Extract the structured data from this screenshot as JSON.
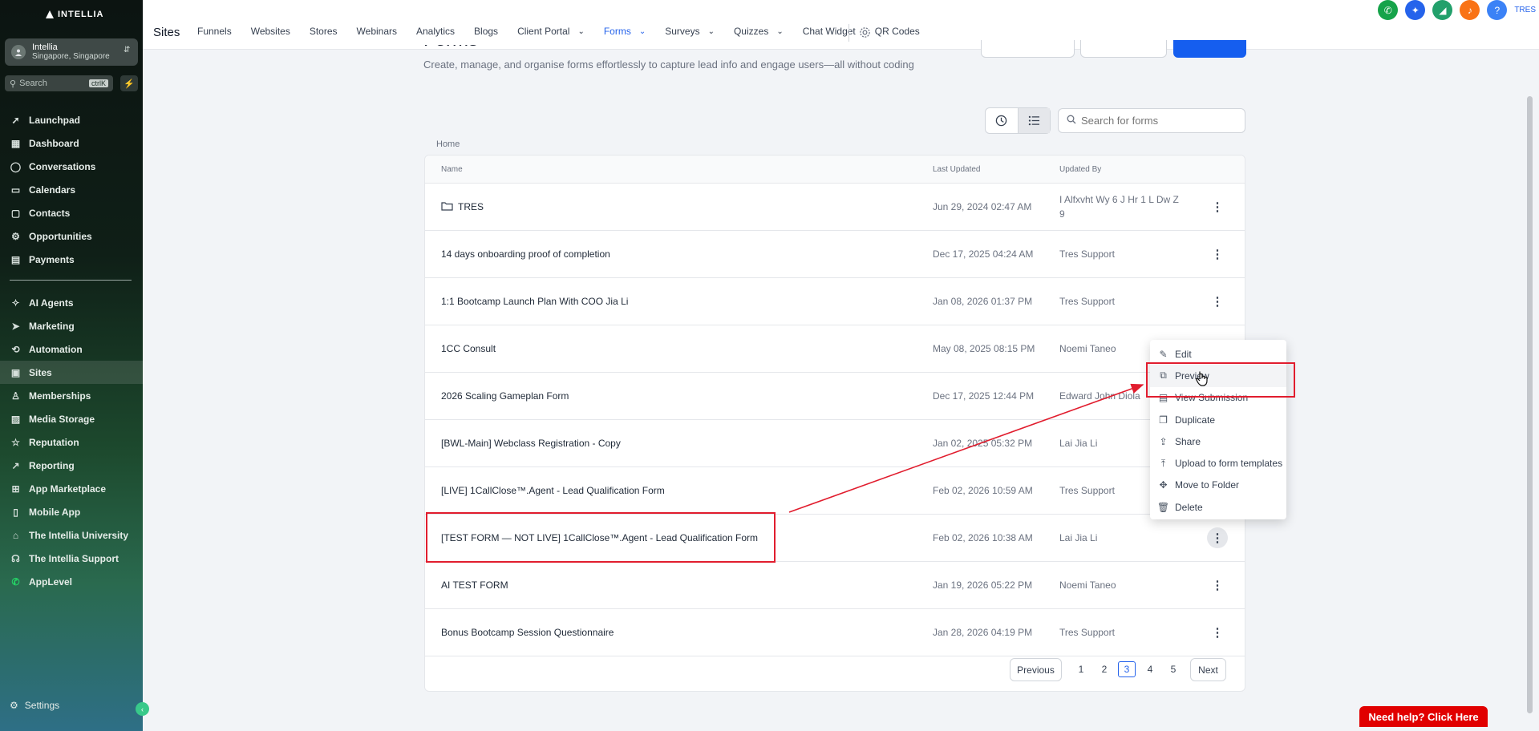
{
  "brand": {
    "name": "INTELLIA"
  },
  "account": {
    "name": "Intellia",
    "location": "Singapore, Singapore"
  },
  "sidebar": {
    "search_placeholder": "Search",
    "search_shortcut": "ctrlK",
    "items": [
      {
        "label": "Launchpad",
        "icon": "rocket-icon"
      },
      {
        "label": "Dashboard",
        "icon": "grid-icon"
      },
      {
        "label": "Conversations",
        "icon": "chat-icon"
      },
      {
        "label": "Calendars",
        "icon": "calendar-icon"
      },
      {
        "label": "Contacts",
        "icon": "contacts-icon"
      },
      {
        "label": "Opportunities",
        "icon": "opportunities-icon"
      },
      {
        "label": "Payments",
        "icon": "payments-icon"
      }
    ],
    "items2": [
      {
        "label": "AI Agents",
        "icon": "sparkle-icon"
      },
      {
        "label": "Marketing",
        "icon": "send-icon"
      },
      {
        "label": "Automation",
        "icon": "automation-icon"
      },
      {
        "label": "Sites",
        "icon": "sites-icon"
      },
      {
        "label": "Memberships",
        "icon": "membership-icon"
      },
      {
        "label": "Media Storage",
        "icon": "media-icon"
      },
      {
        "label": "Reputation",
        "icon": "star-icon"
      },
      {
        "label": "Reporting",
        "icon": "trend-icon"
      },
      {
        "label": "App Marketplace",
        "icon": "apps-icon"
      },
      {
        "label": "Mobile App",
        "icon": "phone-icon"
      },
      {
        "label": "The Intellia University",
        "icon": "graduation-icon"
      },
      {
        "label": "The Intellia Support",
        "icon": "support-icon"
      },
      {
        "label": "AppLevel",
        "icon": "whatsapp-icon"
      }
    ],
    "settings": "Settings"
  },
  "topnav": {
    "title": "Sites",
    "tabs": [
      "Funnels",
      "Websites",
      "Stores",
      "Webinars",
      "Analytics",
      "Blogs",
      "Client Portal",
      "Forms",
      "Surveys",
      "Quizzes",
      "Chat Widget",
      "QR Codes"
    ],
    "user": "TRES"
  },
  "page": {
    "title": "Forms",
    "description": "Create, manage, and organise forms effortlessly to capture lead info and engage users—all without coding",
    "search_placeholder": "Search for forms",
    "breadcrumb": "Home"
  },
  "table": {
    "columns": [
      "Name",
      "Last Updated",
      "Updated By"
    ],
    "rows": [
      {
        "name": "TRES",
        "date": "Jun 29, 2024 02:47 AM",
        "by": "I Alfxvht Wy 6 J Hr 1 L Dw Z 9",
        "folder": true
      },
      {
        "name": "14 days onboarding proof of completion",
        "date": "Dec 17, 2025 04:24 AM",
        "by": "Tres Support"
      },
      {
        "name": "1:1 Bootcamp Launch Plan With COO Jia Li",
        "date": "Jan 08, 2026 01:37 PM",
        "by": "Tres Support"
      },
      {
        "name": "1CC Consult",
        "date": "May 08, 2025 08:15 PM",
        "by": "Noemi Taneo"
      },
      {
        "name": "2026 Scaling Gameplan Form",
        "date": "Dec 17, 2025 12:44 PM",
        "by": "Edward John Diola"
      },
      {
        "name": "[BWL-Main] Webclass Registration - Copy",
        "date": "Jan 02, 2025 05:32 PM",
        "by": "Lai Jia Li"
      },
      {
        "name": "[LIVE] 1CallClose™.Agent - Lead Qualification Form",
        "date": "Feb 02, 2026 10:59 AM",
        "by": "Tres Support"
      },
      {
        "name": "[TEST FORM — NOT LIVE] 1CallClose™.Agent - Lead Qualification Form",
        "date": "Feb 02, 2026 10:38 AM",
        "by": "Lai Jia Li"
      },
      {
        "name": "AI TEST FORM",
        "date": "Jan 19, 2026 05:22 PM",
        "by": "Noemi Taneo"
      },
      {
        "name": "Bonus Bootcamp Session Questionnaire",
        "date": "Jan 28, 2026 04:19 PM",
        "by": "Tres Support"
      }
    ]
  },
  "pagination": {
    "previous": "Previous",
    "next": "Next",
    "pages": [
      "1",
      "2",
      "3",
      "4",
      "5"
    ],
    "current": "3"
  },
  "context_menu": {
    "items": [
      {
        "label": "Edit",
        "icon": "pencil-icon"
      },
      {
        "label": "Preview",
        "icon": "external-link-icon"
      },
      {
        "label": "View Submission",
        "icon": "document-icon"
      },
      {
        "label": "Duplicate",
        "icon": "copy-icon"
      },
      {
        "label": "Share",
        "icon": "share-icon"
      },
      {
        "label": "Upload to form templates",
        "icon": "upload-icon"
      },
      {
        "label": "Move to Folder",
        "icon": "move-icon"
      },
      {
        "label": "Delete",
        "icon": "trash-icon"
      }
    ]
  },
  "help_button": "Need help? Click Here",
  "colors": {
    "accent": "#2563eb",
    "annotation": "#e11d2e",
    "help": "#e10000"
  }
}
